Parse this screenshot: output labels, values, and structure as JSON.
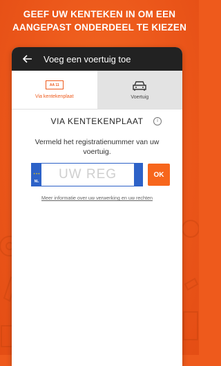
{
  "headline": {
    "line1": "GEEF UW KENTEKEN IN OM EEN",
    "line2": "AANGEPAST ONDERDEEL TE KIEZEN"
  },
  "appbar": {
    "title": "Voeg een voertuig toe",
    "back_icon": "arrow-left-icon"
  },
  "tabs": [
    {
      "label": "Via kentekenplaat",
      "icon": "license-plate-icon",
      "icon_text": "AA 11",
      "active": true
    },
    {
      "label": "Voertuig",
      "icon": "car-icon",
      "active": false
    }
  ],
  "section": {
    "title": "VIA KENTEKENPLAAT",
    "info_icon": "info-icon"
  },
  "instruction": "Vermeld het registratienummer van uw voertuig.",
  "plate": {
    "country": "NL",
    "placeholder": "UW REG",
    "value": ""
  },
  "ok_label": "OK",
  "privacy_link": "Meer informatie over uw verwerking en uw rechten",
  "colors": {
    "accent": "#ee5a1c",
    "appbar": "#222222",
    "plate_blue": "#2d62c8",
    "tab_inactive": "#e3e3e3"
  }
}
